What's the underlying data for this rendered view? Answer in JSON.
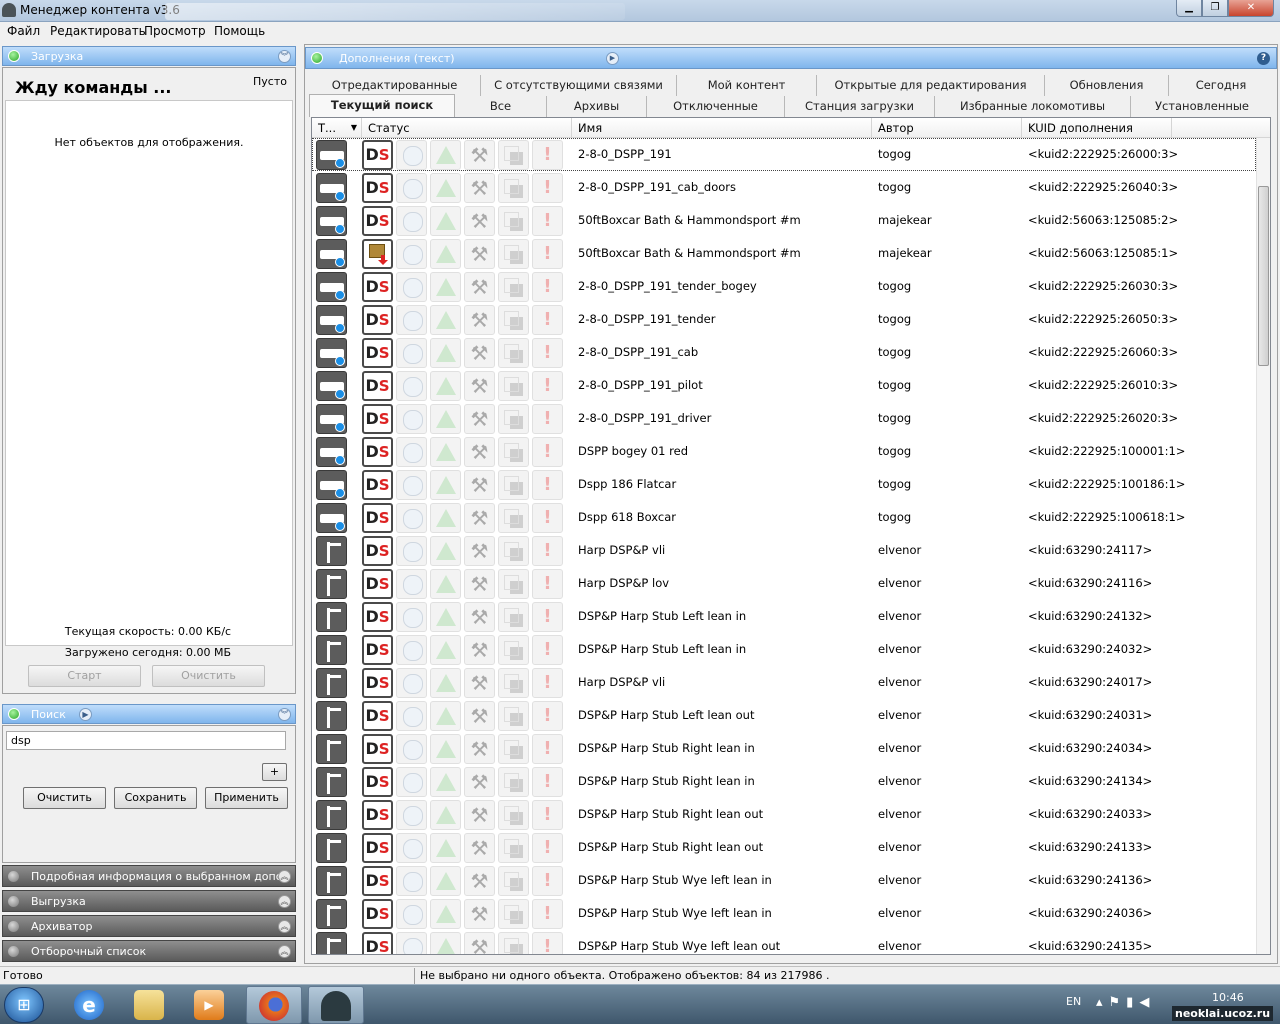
{
  "window": {
    "title": "Менеджер контента v3.6"
  },
  "menu": [
    "Файл",
    "Редактировать",
    "Просмотр",
    "Помощь"
  ],
  "download": {
    "header": "Загрузка",
    "status": "Жду команды ...",
    "queue_state": "Пусто",
    "empty_text": "Нет объектов для отображения.",
    "speed": "Текущая скорость: 0.00 КБ/с",
    "today": "Загружено сегодня: 0.00 МБ",
    "start_label": "Старт",
    "clear_label": "Очистить"
  },
  "search": {
    "header": "Поиск",
    "value": "dsp",
    "add_label": "+",
    "clear_label": "Очистить",
    "save_label": "Сохранить",
    "apply_label": "Применить"
  },
  "collapsed_panels": [
    "Подробная информация о выбранном дополнении",
    "Выгрузка",
    "Архиватор",
    "Отборочный список"
  ],
  "addons": {
    "header": "Дополнения (текст)",
    "help": "?",
    "tabs_row1": [
      "Отредактированные",
      "С отсутствующими связями",
      "Мой контент",
      "Открытые для редактирования",
      "Обновления",
      "Сегодня"
    ],
    "tabs_row2": [
      "Текущий поиск",
      "Все",
      "Архивы",
      "Отключенные",
      "Станция загрузки",
      "Избранные локомотивы",
      "Установленные"
    ],
    "active_tab": "Текущий поиск",
    "columns": {
      "type": "Т...",
      "status": "Статус",
      "name": "Имя",
      "author": "Автор",
      "kuid": "KUID дополнения"
    },
    "rows": [
      {
        "type": "train",
        "status": "ds",
        "name": "2-8-0_DSPP_191",
        "author": "togog",
        "kuid": "<kuid2:222925:26000:3>"
      },
      {
        "type": "train",
        "status": "ds",
        "name": "2-8-0_DSPP_191_cab_doors",
        "author": "togog",
        "kuid": "<kuid2:222925:26040:3>"
      },
      {
        "type": "train",
        "status": "ds",
        "name": "50ftBoxcar Bath & Hammondsport #m",
        "author": "majekear",
        "kuid": "<kuid2:56063:125085:2>"
      },
      {
        "type": "train",
        "status": "download",
        "name": "50ftBoxcar Bath & Hammondsport #m",
        "author": "majekear",
        "kuid": "<kuid2:56063:125085:1>"
      },
      {
        "type": "train",
        "status": "ds",
        "name": "2-8-0_DSPP_191_tender_bogey",
        "author": "togog",
        "kuid": "<kuid2:222925:26030:3>"
      },
      {
        "type": "train",
        "status": "ds",
        "name": "2-8-0_DSPP_191_tender",
        "author": "togog",
        "kuid": "<kuid2:222925:26050:3>"
      },
      {
        "type": "train",
        "status": "ds",
        "name": "2-8-0_DSPP_191_cab",
        "author": "togog",
        "kuid": "<kuid2:222925:26060:3>"
      },
      {
        "type": "train",
        "status": "ds",
        "name": "2-8-0_DSPP_191_pilot",
        "author": "togog",
        "kuid": "<kuid2:222925:26010:3>"
      },
      {
        "type": "train",
        "status": "ds",
        "name": "2-8-0_DSPP_191_driver",
        "author": "togog",
        "kuid": "<kuid2:222925:26020:3>"
      },
      {
        "type": "train",
        "status": "ds",
        "name": "DSPP bogey 01 red",
        "author": "togog",
        "kuid": "<kuid2:222925:100001:1>"
      },
      {
        "type": "train",
        "status": "ds",
        "name": "Dspp 186 Flatcar",
        "author": "togog",
        "kuid": "<kuid2:222925:100186:1>"
      },
      {
        "type": "train",
        "status": "ds",
        "name": "Dspp 618 Boxcar",
        "author": "togog",
        "kuid": "<kuid2:222925:100618:1>"
      },
      {
        "type": "pole",
        "status": "ds",
        "name": "Harp DSP&P vli",
        "author": "elvenor",
        "kuid": "<kuid:63290:24117>"
      },
      {
        "type": "pole",
        "status": "ds",
        "name": "Harp DSP&P lov",
        "author": "elvenor",
        "kuid": "<kuid:63290:24116>"
      },
      {
        "type": "pole",
        "status": "ds",
        "name": "DSP&P Harp Stub Left lean in",
        "author": "elvenor",
        "kuid": "<kuid:63290:24132>"
      },
      {
        "type": "pole",
        "status": "ds",
        "name": "DSP&P Harp Stub Left lean in",
        "author": "elvenor",
        "kuid": "<kuid:63290:24032>"
      },
      {
        "type": "pole",
        "status": "ds",
        "name": "Harp DSP&P vli",
        "author": "elvenor",
        "kuid": "<kuid:63290:24017>"
      },
      {
        "type": "pole",
        "status": "ds",
        "name": "DSP&P Harp Stub Left lean out",
        "author": "elvenor",
        "kuid": "<kuid:63290:24031>"
      },
      {
        "type": "pole",
        "status": "ds",
        "name": "DSP&P Harp Stub Right lean in",
        "author": "elvenor",
        "kuid": "<kuid:63290:24034>"
      },
      {
        "type": "pole",
        "status": "ds",
        "name": "DSP&P Harp Stub Right lean in",
        "author": "elvenor",
        "kuid": "<kuid:63290:24134>"
      },
      {
        "type": "pole",
        "status": "ds",
        "name": "DSP&P Harp Stub Right lean out",
        "author": "elvenor",
        "kuid": "<kuid:63290:24033>"
      },
      {
        "type": "pole",
        "status": "ds",
        "name": "DSP&P Harp Stub Right lean out",
        "author": "elvenor",
        "kuid": "<kuid:63290:24133>"
      },
      {
        "type": "pole",
        "status": "ds",
        "name": "DSP&P Harp Stub Wye left lean in",
        "author": "elvenor",
        "kuid": "<kuid:63290:24136>"
      },
      {
        "type": "pole",
        "status": "ds",
        "name": "DSP&P Harp Stub Wye left lean in",
        "author": "elvenor",
        "kuid": "<kuid:63290:24036>"
      },
      {
        "type": "pole",
        "status": "ds",
        "name": "DSP&P Harp Stub Wye left lean out",
        "author": "elvenor",
        "kuid": "<kuid:63290:24135>"
      }
    ]
  },
  "statusbar": {
    "left": "Готово",
    "right": "Не выбрано ни одного объекта. Отображено объектов: 84 из 217986 ."
  },
  "taskbar": {
    "lang": "EN",
    "time": "10:46",
    "apps": [
      "start-orb",
      "ie-icon",
      "explorer-icon",
      "media-player-icon",
      "firefox-icon",
      "content-manager-icon"
    ]
  },
  "watermark": "neoklai.ucoz.ru"
}
